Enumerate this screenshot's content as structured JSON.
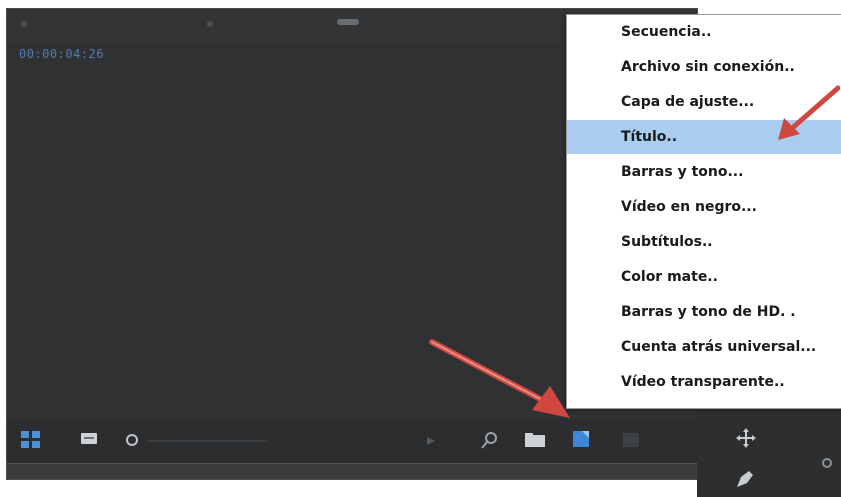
{
  "timecode": "00:00:04:26",
  "bottom_status": "",
  "menu": {
    "items": [
      {
        "label": "Secuencia..",
        "highlighted": false
      },
      {
        "label": "Archivo sin conexión..",
        "highlighted": false
      },
      {
        "label": "Capa de ajuste...",
        "highlighted": false
      },
      {
        "label": "Título..",
        "highlighted": true
      },
      {
        "label": "Barras y tono...",
        "highlighted": false
      },
      {
        "label": "Vídeo en negro...",
        "highlighted": false
      },
      {
        "label": "Subtítulos..",
        "highlighted": false
      },
      {
        "label": "Color mate..",
        "highlighted": false
      },
      {
        "label": "Barras y tono de HD. .",
        "highlighted": false
      },
      {
        "label": "Cuenta atrás universal...",
        "highlighted": false
      },
      {
        "label": "Vídeo transparente..",
        "highlighted": false
      }
    ]
  },
  "colors": {
    "panel_bg": "#2f3133",
    "menu_highlight": "#a8cdef",
    "arrow_red": "#d0473f",
    "accent_blue": "#4f8fd6"
  }
}
